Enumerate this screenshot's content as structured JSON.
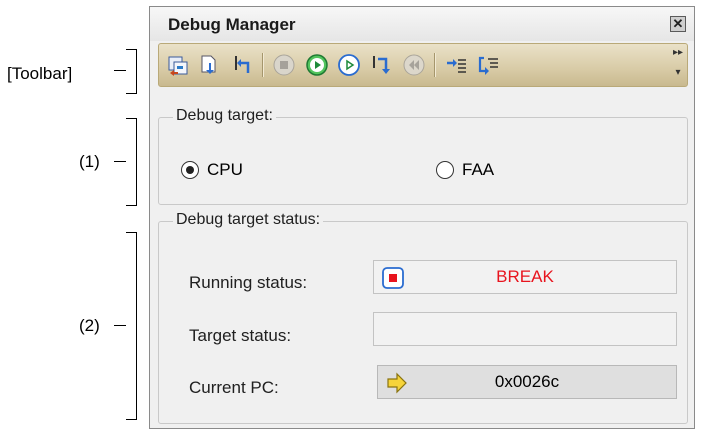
{
  "callouts": {
    "toolbar": "[Toolbar]",
    "section1": "(1)",
    "section2": "(2)"
  },
  "window": {
    "title": "Debug Manager",
    "close_icon": "close-icon"
  },
  "toolbar": {
    "buttons": [
      {
        "name": "download-icon"
      },
      {
        "name": "step-in-icon"
      },
      {
        "name": "return-out-icon"
      },
      {
        "name": "stop-icon"
      },
      {
        "name": "go-icon"
      },
      {
        "name": "run-icon"
      },
      {
        "name": "step-over-icon"
      },
      {
        "name": "back-step-icon"
      },
      {
        "name": "trace-icon"
      },
      {
        "name": "trace-return-icon"
      }
    ],
    "more": "»"
  },
  "debug_target": {
    "title": "Debug target:",
    "options": [
      {
        "label": "CPU",
        "selected": true
      },
      {
        "label": "FAA",
        "selected": false
      }
    ]
  },
  "debug_status": {
    "title": "Debug target status:",
    "running_label": "Running status:",
    "running_value": "BREAK",
    "target_label": "Target status:",
    "target_value": "",
    "pc_label": "Current PC:",
    "pc_value": "0x0026c"
  },
  "colors": {
    "break_text": "#e8141e",
    "toolbar_bg": "#d8cba6",
    "accent_green": "#2ea44f"
  }
}
